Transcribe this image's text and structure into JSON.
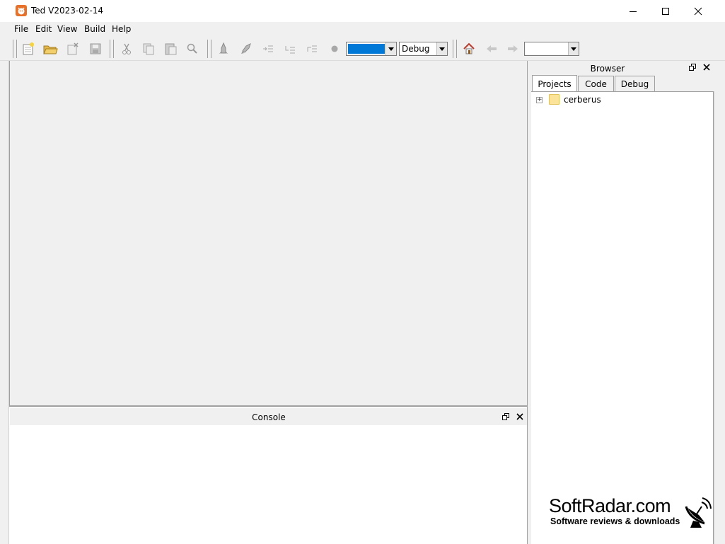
{
  "window": {
    "title": "Ted V2023-02-14"
  },
  "menu": {
    "items": [
      "File",
      "Edit",
      "View",
      "Build",
      "Help"
    ]
  },
  "toolbar": {
    "target_combo_value": "",
    "config_combo_value": "Debug",
    "nav_combo_value": ""
  },
  "browser": {
    "title": "Browser",
    "tabs": [
      "Projects",
      "Code",
      "Debug"
    ],
    "active_tab": "Projects",
    "tree": [
      {
        "label": "cerberus",
        "icon": "folder-icon",
        "expander": "+"
      }
    ]
  },
  "console": {
    "title": "Console"
  },
  "watermark": {
    "title": "SoftRadar.com",
    "subtitle": "Software reviews & downloads"
  },
  "colors": {
    "editor_bg": "#f0f0f0",
    "combo_highlight": "#0078d7",
    "app_icon": "#e8712a"
  }
}
